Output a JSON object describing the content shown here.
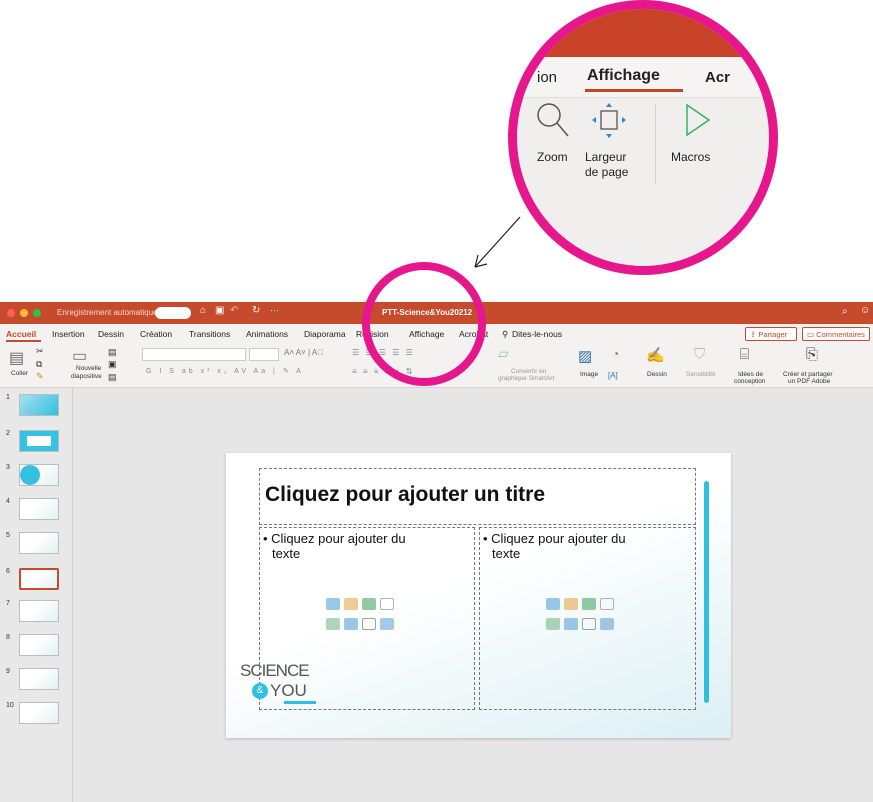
{
  "callout": {
    "tabs": [
      "ion",
      "Affichage",
      "Acr"
    ],
    "buttons": [
      {
        "icon": "zoom-magnifier-icon",
        "label": "Zoom"
      },
      {
        "icon": "page-width-icon",
        "label": "Largeur de page",
        "label_line1": "Largeur",
        "label_line2": "de page"
      },
      {
        "icon": "play-macro-icon",
        "label": "Macros"
      }
    ]
  },
  "titlebar": {
    "autosave": "Enregistrement automatique",
    "doc_title": "PTT-Science&You2021",
    "doc_suffix": "2"
  },
  "tabs": [
    "Accueil",
    "Insertion",
    "Dessin",
    "Création",
    "Transitions",
    "Animations",
    "Diaporama",
    "Révision",
    "Affichage",
    "Acrobat",
    "Dites-le-nous"
  ],
  "share": {
    "partager": "Partager",
    "commentaires": "Commentaires"
  },
  "ribbon": {
    "coller": "Coller",
    "nouvelle_1": "Nouvelle",
    "nouvelle_2": "diapositive",
    "convertir_1": "Convertir en",
    "convertir_2": "graphique SmartArt",
    "image": "Image",
    "dessin": "Dessin",
    "sensibilite": "Sensibilité",
    "idees_1": "Idées de",
    "idees_2": "conception",
    "pdf_1": "Créer et partager",
    "pdf_2": "un PDF Adobe"
  },
  "thumbnails": [
    "1",
    "2",
    "3",
    "4",
    "5",
    "6",
    "7",
    "8",
    "9",
    "10"
  ],
  "selected_slide": 6,
  "slide": {
    "title_placeholder": "Cliquez pour ajouter un titre",
    "left_text_1": "• Cliquez pour ajouter du",
    "left_text_2": "texte",
    "right_text_1": "• Cliquez pour ajouter du",
    "right_text_2": "texte",
    "logo_1": "SCIENCE",
    "logo_amp": "&",
    "logo_2": "YOU"
  },
  "colors": {
    "accent": "#c64a2c",
    "highlight": "#e6168c",
    "cyan": "#2fc0e0"
  }
}
